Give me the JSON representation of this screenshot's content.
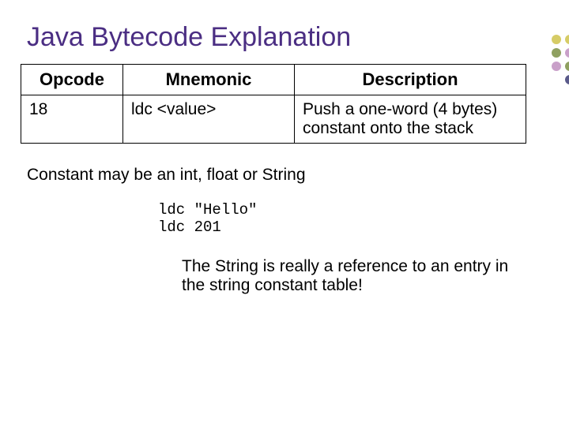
{
  "title": "Java Bytecode Explanation",
  "table": {
    "headers": {
      "opcode": "Opcode",
      "mnemonic": "Mnemonic",
      "description": "Description"
    },
    "rows": [
      {
        "opcode": "18",
        "mnemonic": "ldc <value>",
        "description": "Push a one-word (4 bytes) constant onto the stack"
      }
    ]
  },
  "note_constant": "Constant may be an int, float or String",
  "code_example": "ldc \"Hello\"\nldc 201",
  "note_string": "The String is really a reference to an entry in the string constant table!"
}
